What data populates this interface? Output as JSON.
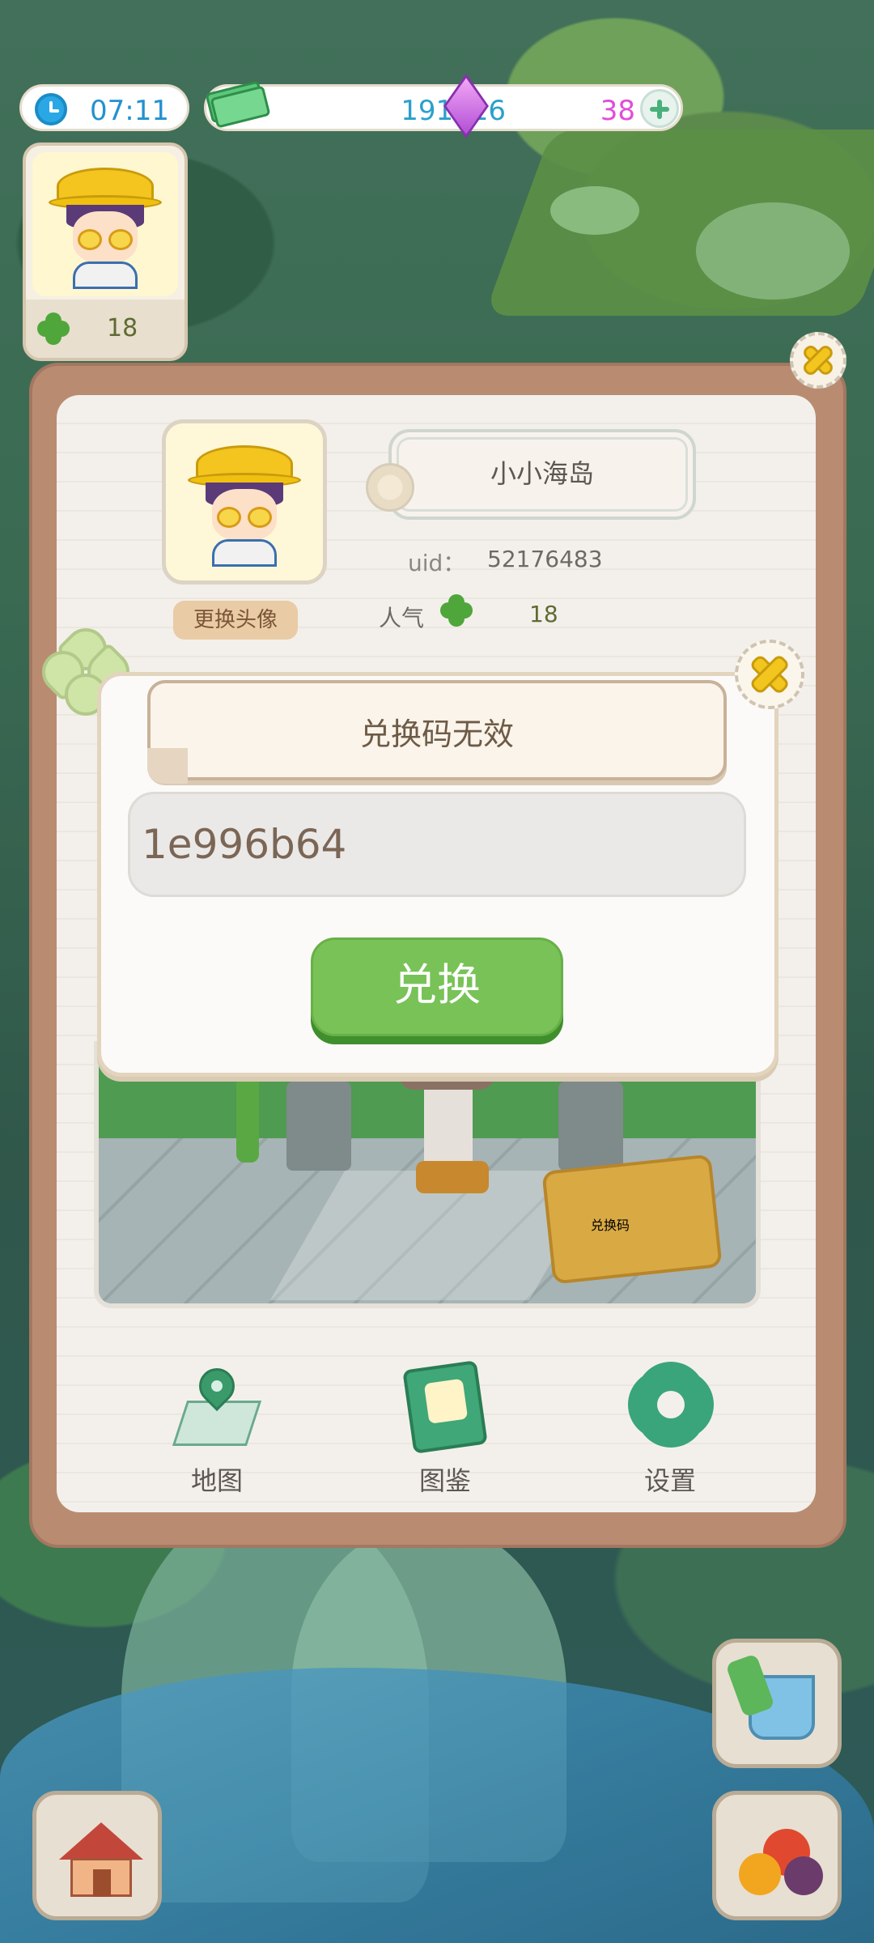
{
  "hud": {
    "time": "07:11",
    "cash": "191316",
    "gems": "38"
  },
  "mini_profile": {
    "popularity": "18"
  },
  "profile": {
    "name": "小小海岛",
    "uid_label": "uid：",
    "uid": "52176483",
    "change_avatar_label": "更换头像",
    "popularity_label": "人气",
    "popularity": "18"
  },
  "scene": {
    "bag_label": "兑换码"
  },
  "nav": [
    {
      "label": "地图",
      "icon": "map-pin-icon"
    },
    {
      "label": "图鉴",
      "icon": "book-icon"
    },
    {
      "label": "设置",
      "icon": "gear-icon"
    }
  ],
  "redeem_dialog": {
    "message": "兑换码无效",
    "code_value": "1e996b64",
    "button_label": "兑换"
  },
  "colors": {
    "accent_green": "#78c257",
    "panel_brown": "#b98c72",
    "cash_blue": "#2ba0cc",
    "gem_pink": "#e24dd7"
  }
}
